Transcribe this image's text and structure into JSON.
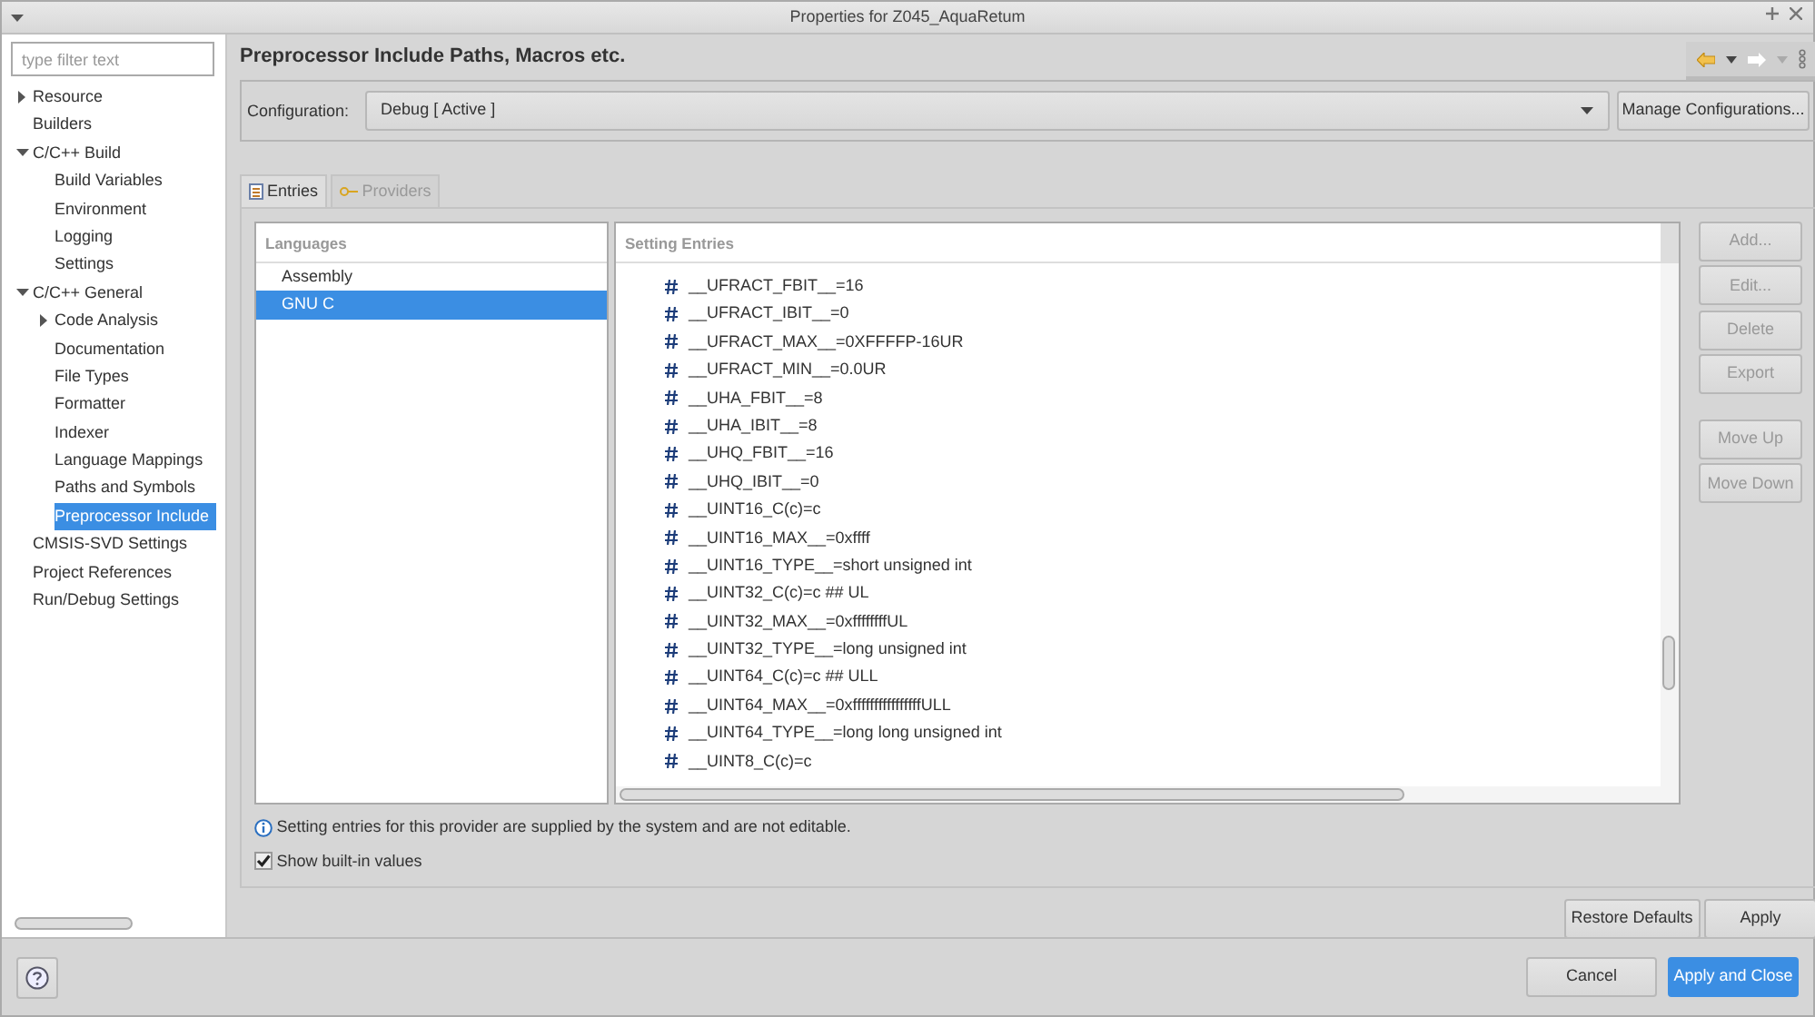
{
  "window": {
    "title": "Properties for Z045_AquaRetum"
  },
  "sidebar": {
    "filter": {
      "placeholder": "type filter text"
    },
    "items": [
      {
        "label": "Resource",
        "expanded": false,
        "selected": false
      },
      {
        "label": "Builders",
        "selected": false
      },
      {
        "label": "C/C++ Build",
        "expanded": true,
        "selected": false,
        "children": [
          {
            "label": "Build Variables",
            "selected": false
          },
          {
            "label": "Environment",
            "selected": false
          },
          {
            "label": "Logging",
            "selected": false
          },
          {
            "label": "Settings",
            "selected": false
          }
        ]
      },
      {
        "label": "C/C++ General",
        "expanded": true,
        "selected": false,
        "children": [
          {
            "label": "Code Analysis",
            "expanded": false,
            "selected": false
          },
          {
            "label": "Documentation",
            "selected": false
          },
          {
            "label": "File Types",
            "selected": false
          },
          {
            "label": "Formatter",
            "selected": false
          },
          {
            "label": "Indexer",
            "selected": false
          },
          {
            "label": "Language Mappings",
            "selected": false
          },
          {
            "label": "Paths and Symbols",
            "selected": false
          },
          {
            "label": "Preprocessor Include",
            "selected": true
          }
        ]
      },
      {
        "label": "CMSIS-SVD Settings",
        "selected": false
      },
      {
        "label": "Project References",
        "selected": false
      },
      {
        "label": "Run/Debug Settings",
        "selected": false
      }
    ]
  },
  "page": {
    "title": "Preprocessor Include Paths, Macros etc.",
    "configuration": {
      "label": "Configuration:",
      "value": "Debug  [ Active ]",
      "manage_button": "Manage Configurations..."
    },
    "tabs": [
      {
        "label": "Entries",
        "selected": true
      },
      {
        "label": "Providers",
        "selected": false
      }
    ],
    "languages": {
      "header": "Languages",
      "items": [
        {
          "label": "Assembly",
          "selected": false
        },
        {
          "label": "GNU C",
          "selected": true
        }
      ]
    },
    "entries": {
      "header": "Setting Entries",
      "items": [
        "__UFRACT_FBIT__=16",
        "__UFRACT_IBIT__=0",
        "__UFRACT_MAX__=0XFFFFP-16UR",
        "__UFRACT_MIN__=0.0UR",
        "__UHA_FBIT__=8",
        "__UHA_IBIT__=8",
        "__UHQ_FBIT__=16",
        "__UHQ_IBIT__=0",
        "__UINT16_C(c)=c",
        "__UINT16_MAX__=0xffff",
        "__UINT16_TYPE__=short unsigned int",
        "__UINT32_C(c)=c ## UL",
        "__UINT32_MAX__=0xffffffffUL",
        "__UINT32_TYPE__=long unsigned int",
        "__UINT64_C(c)=c ## ULL",
        "__UINT64_MAX__=0xffffffffffffffffULL",
        "__UINT64_TYPE__=long long unsigned int",
        "__UINT8_C(c)=c"
      ]
    },
    "entry_buttons": [
      {
        "label": "Add...",
        "disabled": true
      },
      {
        "label": "Edit...",
        "disabled": true
      },
      {
        "label": "Delete",
        "disabled": true
      },
      {
        "label": "Export",
        "disabled": true
      },
      {
        "label": "Move Up",
        "disabled": true
      },
      {
        "label": "Move Down",
        "disabled": true
      }
    ],
    "info": "Setting entries for this provider are supplied by the system and are not editable.",
    "show_builtin": {
      "label": "Show built-in values",
      "checked": true
    },
    "buttons": [
      "Restore Defaults",
      "Apply"
    ]
  },
  "footer": {
    "buttons": [
      {
        "label": "Cancel",
        "primary": false
      },
      {
        "label": "Apply and Close",
        "primary": true
      }
    ]
  }
}
